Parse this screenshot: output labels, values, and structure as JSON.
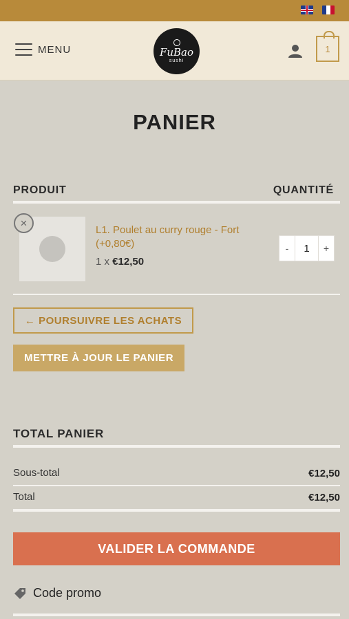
{
  "header": {
    "menu_label": "MENU",
    "logo_text": "FuBao",
    "logo_sub": "sushi",
    "cart_count": "1",
    "colors": {
      "topbar": "#b88a3a",
      "header_bg": "#f1e9d8",
      "accent": "#c19a4b"
    }
  },
  "page": {
    "title": "PANIER"
  },
  "cart_table": {
    "col_product": "PRODUIT",
    "col_quantity": "QUANTITÉ",
    "items": [
      {
        "name": "L1. Poulet au curry rouge - Fort (+0,80€)",
        "qty_prefix": "1 x",
        "price": "€12,50",
        "quantity": "1",
        "minus": "-",
        "plus": "+",
        "remove": "×"
      }
    ]
  },
  "actions": {
    "continue_label": "← POURSUIVRE LES ACHATS",
    "update_label": "METTRE À JOUR LE PANIER"
  },
  "totals": {
    "title": "TOTAL PANIER",
    "subtotal_label": "Sous-total",
    "subtotal_value": "€12,50",
    "total_label": "Total",
    "total_value": "€12,50"
  },
  "checkout": {
    "label": "VALIDER LA COMMANDE",
    "color": "#d9704f"
  },
  "promo": {
    "label": "Code promo"
  }
}
